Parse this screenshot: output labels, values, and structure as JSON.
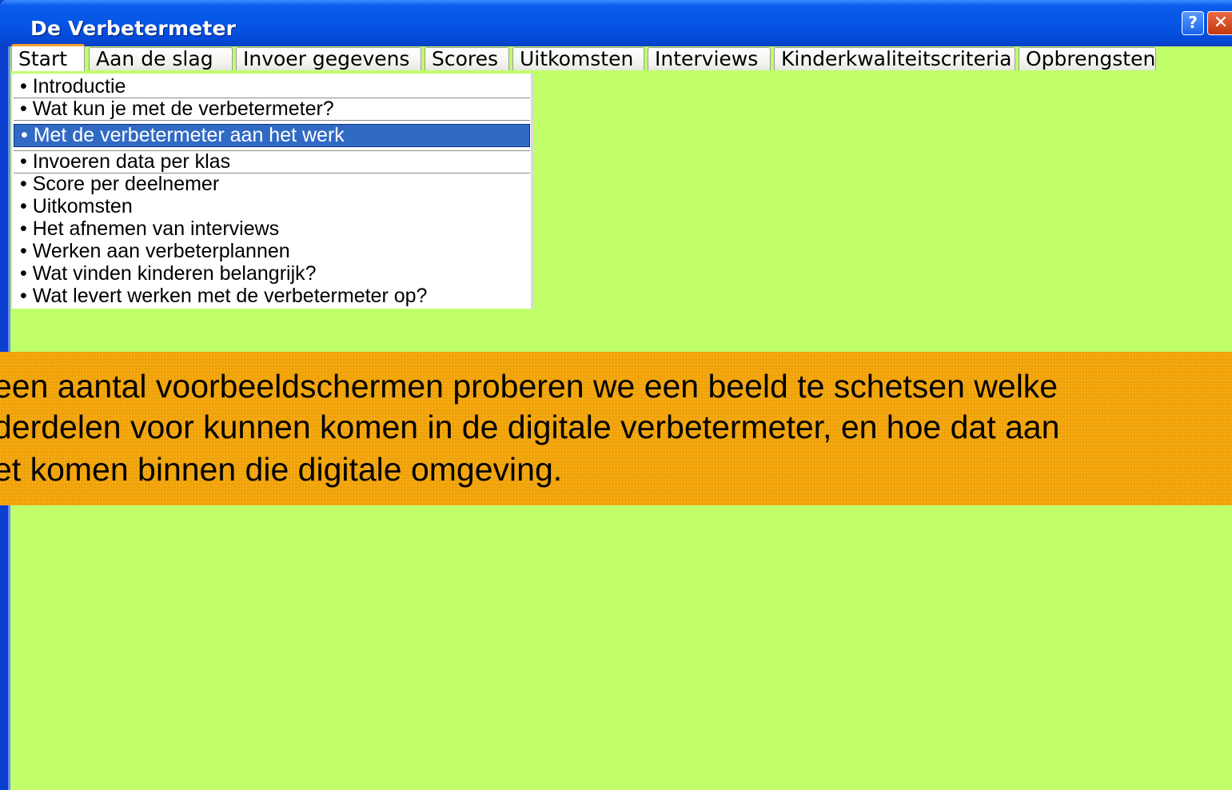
{
  "window": {
    "title": "De Verbetermeter",
    "help_label": "?",
    "close_label": "✕"
  },
  "tabs": [
    {
      "label": "Start",
      "active": true
    },
    {
      "label": "Aan de slag"
    },
    {
      "label": "Invoer gegevens"
    },
    {
      "label": "Scores"
    },
    {
      "label": "Uitkomsten"
    },
    {
      "label": "Interviews"
    },
    {
      "label": "Kinderkwaliteitscriteria"
    },
    {
      "label": "Opbrengsten"
    }
  ],
  "menu": {
    "bullet": "•",
    "items": [
      {
        "label": "• Introductie"
      },
      {
        "label": "• Wat kun je met de verbetermeter?"
      },
      {
        "label": "• Met de verbetermeter aan het werk",
        "selected": true
      },
      {
        "label": "• Invoeren data per klas"
      },
      {
        "label": "• Score per deelnemer"
      },
      {
        "label": "• Uitkomsten"
      },
      {
        "label": "• Het afnemen van interviews"
      },
      {
        "label": "• Werken aan verbeterplannen"
      },
      {
        "label": "• Wat vinden kinderen belangrijk?"
      },
      {
        "label": "• Wat levert werken met de verbetermeter op?"
      }
    ]
  },
  "banner": {
    "lines": [
      "een aantal voorbeeldschermen proberen we een beeld te schetsen welke",
      "derdelen voor kunnen komen in de digitale verbetermeter, en hoe dat aan",
      "et komen binnen die digitale omgeving."
    ]
  },
  "colors": {
    "titlebar": "#0656e6",
    "client_bg": "#c0ff6a",
    "banner_bg": "#f0a000",
    "selection": "#316ac5",
    "active_tab_accent": "#f6a028"
  }
}
